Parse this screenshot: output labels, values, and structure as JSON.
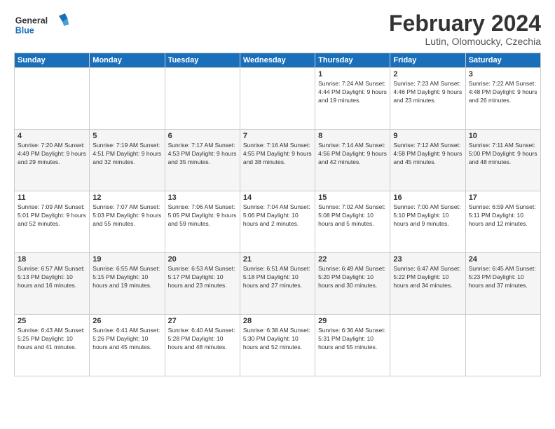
{
  "logo": {
    "general": "General",
    "blue": "Blue"
  },
  "header": {
    "month_year": "February 2024",
    "location": "Lutin, Olomoucky, Czechia"
  },
  "weekdays": [
    "Sunday",
    "Monday",
    "Tuesday",
    "Wednesday",
    "Thursday",
    "Friday",
    "Saturday"
  ],
  "weeks": [
    [
      {
        "day": "",
        "info": ""
      },
      {
        "day": "",
        "info": ""
      },
      {
        "day": "",
        "info": ""
      },
      {
        "day": "",
        "info": ""
      },
      {
        "day": "1",
        "info": "Sunrise: 7:24 AM\nSunset: 4:44 PM\nDaylight: 9 hours\nand 19 minutes."
      },
      {
        "day": "2",
        "info": "Sunrise: 7:23 AM\nSunset: 4:46 PM\nDaylight: 9 hours\nand 23 minutes."
      },
      {
        "day": "3",
        "info": "Sunrise: 7:22 AM\nSunset: 4:48 PM\nDaylight: 9 hours\nand 26 minutes."
      }
    ],
    [
      {
        "day": "4",
        "info": "Sunrise: 7:20 AM\nSunset: 4:49 PM\nDaylight: 9 hours\nand 29 minutes."
      },
      {
        "day": "5",
        "info": "Sunrise: 7:19 AM\nSunset: 4:51 PM\nDaylight: 9 hours\nand 32 minutes."
      },
      {
        "day": "6",
        "info": "Sunrise: 7:17 AM\nSunset: 4:53 PM\nDaylight: 9 hours\nand 35 minutes."
      },
      {
        "day": "7",
        "info": "Sunrise: 7:16 AM\nSunset: 4:55 PM\nDaylight: 9 hours\nand 38 minutes."
      },
      {
        "day": "8",
        "info": "Sunrise: 7:14 AM\nSunset: 4:56 PM\nDaylight: 9 hours\nand 42 minutes."
      },
      {
        "day": "9",
        "info": "Sunrise: 7:12 AM\nSunset: 4:58 PM\nDaylight: 9 hours\nand 45 minutes."
      },
      {
        "day": "10",
        "info": "Sunrise: 7:11 AM\nSunset: 5:00 PM\nDaylight: 9 hours\nand 48 minutes."
      }
    ],
    [
      {
        "day": "11",
        "info": "Sunrise: 7:09 AM\nSunset: 5:01 PM\nDaylight: 9 hours\nand 52 minutes."
      },
      {
        "day": "12",
        "info": "Sunrise: 7:07 AM\nSunset: 5:03 PM\nDaylight: 9 hours\nand 55 minutes."
      },
      {
        "day": "13",
        "info": "Sunrise: 7:06 AM\nSunset: 5:05 PM\nDaylight: 9 hours\nand 59 minutes."
      },
      {
        "day": "14",
        "info": "Sunrise: 7:04 AM\nSunset: 5:06 PM\nDaylight: 10 hours\nand 2 minutes."
      },
      {
        "day": "15",
        "info": "Sunrise: 7:02 AM\nSunset: 5:08 PM\nDaylight: 10 hours\nand 5 minutes."
      },
      {
        "day": "16",
        "info": "Sunrise: 7:00 AM\nSunset: 5:10 PM\nDaylight: 10 hours\nand 9 minutes."
      },
      {
        "day": "17",
        "info": "Sunrise: 6:59 AM\nSunset: 5:11 PM\nDaylight: 10 hours\nand 12 minutes."
      }
    ],
    [
      {
        "day": "18",
        "info": "Sunrise: 6:57 AM\nSunset: 5:13 PM\nDaylight: 10 hours\nand 16 minutes."
      },
      {
        "day": "19",
        "info": "Sunrise: 6:55 AM\nSunset: 5:15 PM\nDaylight: 10 hours\nand 19 minutes."
      },
      {
        "day": "20",
        "info": "Sunrise: 6:53 AM\nSunset: 5:17 PM\nDaylight: 10 hours\nand 23 minutes."
      },
      {
        "day": "21",
        "info": "Sunrise: 6:51 AM\nSunset: 5:18 PM\nDaylight: 10 hours\nand 27 minutes."
      },
      {
        "day": "22",
        "info": "Sunrise: 6:49 AM\nSunset: 5:20 PM\nDaylight: 10 hours\nand 30 minutes."
      },
      {
        "day": "23",
        "info": "Sunrise: 6:47 AM\nSunset: 5:22 PM\nDaylight: 10 hours\nand 34 minutes."
      },
      {
        "day": "24",
        "info": "Sunrise: 6:45 AM\nSunset: 5:23 PM\nDaylight: 10 hours\nand 37 minutes."
      }
    ],
    [
      {
        "day": "25",
        "info": "Sunrise: 6:43 AM\nSunset: 5:25 PM\nDaylight: 10 hours\nand 41 minutes."
      },
      {
        "day": "26",
        "info": "Sunrise: 6:41 AM\nSunset: 5:26 PM\nDaylight: 10 hours\nand 45 minutes."
      },
      {
        "day": "27",
        "info": "Sunrise: 6:40 AM\nSunset: 5:28 PM\nDaylight: 10 hours\nand 48 minutes."
      },
      {
        "day": "28",
        "info": "Sunrise: 6:38 AM\nSunset: 5:30 PM\nDaylight: 10 hours\nand 52 minutes."
      },
      {
        "day": "29",
        "info": "Sunrise: 6:36 AM\nSunset: 5:31 PM\nDaylight: 10 hours\nand 55 minutes."
      },
      {
        "day": "",
        "info": ""
      },
      {
        "day": "",
        "info": ""
      }
    ]
  ]
}
